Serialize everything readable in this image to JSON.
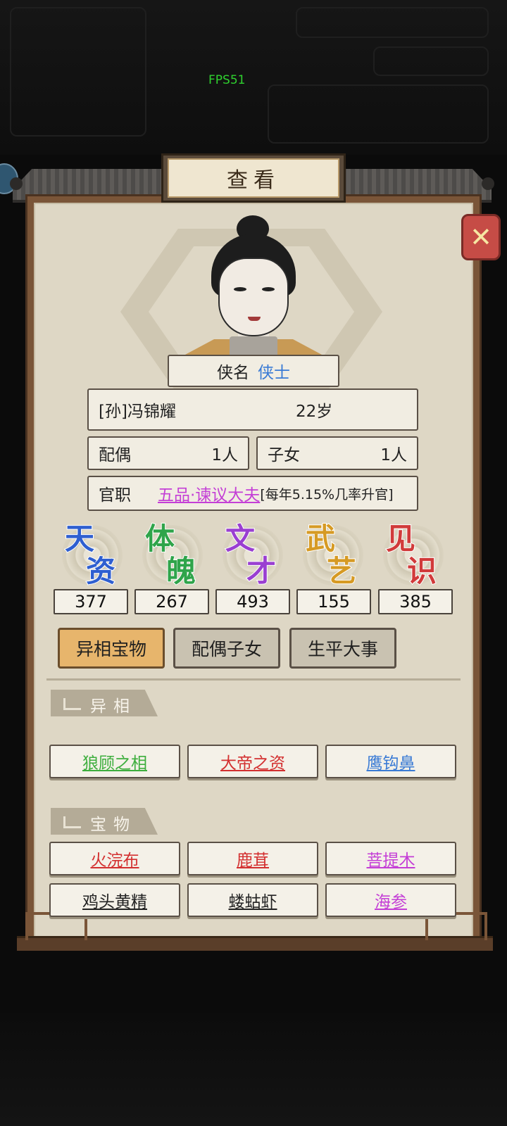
{
  "fps": "FPS51",
  "title": "查看",
  "close_icon": "close-icon",
  "title_name": {
    "label": "侠名",
    "value": "侠士"
  },
  "person": {
    "name": "[孙]冯锦耀",
    "age": "22岁"
  },
  "family": {
    "spouse_label": "配偶",
    "spouse_count": "1人",
    "children_label": "子女",
    "children_count": "1人"
  },
  "office": {
    "label": "官职",
    "rank": "五品·谏议大夫",
    "note": "[每年5.15%几率升官]"
  },
  "stats": [
    {
      "c1": "天",
      "c2": "资",
      "value": "377",
      "color": "#2f5fd0"
    },
    {
      "c1": "体",
      "c2": "魄",
      "value": "267",
      "color": "#2fa44a"
    },
    {
      "c1": "文",
      "c2": "才",
      "value": "493",
      "color": "#9a3fd1"
    },
    {
      "c1": "武",
      "c2": "艺",
      "value": "155",
      "color": "#d69a24"
    },
    {
      "c1": "见",
      "c2": "识",
      "value": "385",
      "color": "#d13a3a"
    }
  ],
  "tabs": [
    "异相宝物",
    "配偶子女",
    "生平大事"
  ],
  "sections": {
    "traits": "异相",
    "treasures": "宝物"
  },
  "traits": [
    {
      "label": "狼顾之相",
      "color": "#3dae3d"
    },
    {
      "label": "大帝之资",
      "color": "#d33030"
    },
    {
      "label": "鹰钩鼻",
      "color": "#3a7bd5"
    }
  ],
  "treasures": [
    {
      "label": "火浣布",
      "color": "#d33030"
    },
    {
      "label": "鹿茸",
      "color": "#d33030"
    },
    {
      "label": "菩提木",
      "color": "#c43fd6"
    },
    {
      "label": "鸡头黄精",
      "color": "#222222"
    },
    {
      "label": "蝼蛄虾",
      "color": "#222222"
    },
    {
      "label": "海参",
      "color": "#c43fd6"
    }
  ]
}
